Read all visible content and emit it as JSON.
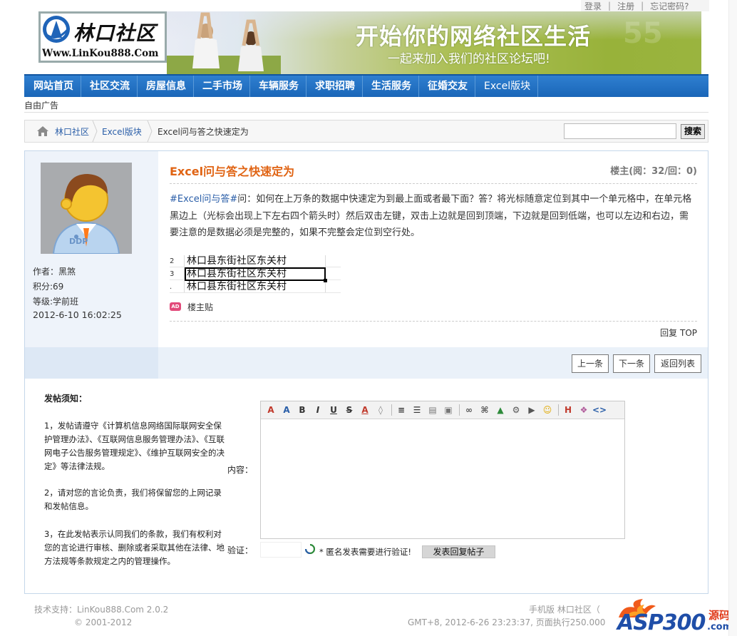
{
  "toplinks": {
    "login": "登录",
    "register": "注册",
    "forgot": "忘记密码?"
  },
  "brand": {
    "logo_text": "林口社区",
    "logo_url": "Www.LinKou888.Com"
  },
  "banner": {
    "slogan": "开始你的网络社区生活",
    "subslogan": "一起来加入我们的社区论坛吧!"
  },
  "nav": {
    "items": [
      "网站首页",
      "社区交流",
      "房屋信息",
      "二手市场",
      "车辆服务",
      "求职招聘",
      "生活服务",
      "征婚交友",
      "Excel版块"
    ]
  },
  "free_ad": "自由广告",
  "breadcrumb": {
    "items": [
      "林口社区",
      "Excel版块",
      "Excel问与答之快速定为"
    ]
  },
  "search": {
    "button": "搜索",
    "placeholder": ""
  },
  "author": {
    "name_line": "作者：黑煞",
    "points_line": "积分:69",
    "level_line": "等级:学前班",
    "date": "2012-6-10 16:02:25"
  },
  "post": {
    "title": "Excel问与答之快速定为",
    "stats": "楼主(阅：32/回：0)",
    "tag": "#Excel问与答#",
    "body": "问：如何在上万条的数据中快速定为到最上面或者最下面？答？将光标随意定位到其中一个单元格中，在单元格黑边上（光标会出现上下左右四个箭头时）然后双击左键，双击上边就是回到顶端，下边就是回到低端，也可以左边和右边，需要注意的是数据必须是完整的，如果不完整会定位到空行处。",
    "excel_rows": [
      {
        "num": "2",
        "text": "林口县东街社区东关村"
      },
      {
        "num": "3",
        "text": "林口县东街社区东关村"
      },
      {
        "num": ".",
        "text": "林口县东街社区东关村"
      }
    ],
    "badge": "AD",
    "floor_label": "楼主贴",
    "reply_top": "回复 TOP"
  },
  "pager": {
    "prev": "上一条",
    "next": "下一条",
    "back": "返回列表"
  },
  "rules": {
    "title": "发帖须知：",
    "r1": "1，发帖请遵守《计算机信息网络国际联网安全保护管理办法》、《互联网信息服务管理办法》、《互联网电子公告服务管理规定》、《维护互联网安全的决定》等法律法规。",
    "r2": "2，请对您的言论负责，我们将保留您的上网记录和发帖信息。",
    "r3": "3，在此发帖表示认同我们的条款，我们有权利对您的言论进行审核、删除或者采取其他在法律、地方法规等条款规定之内的管理操作。"
  },
  "form": {
    "content_label": "内容：",
    "verify_label": "验证：",
    "verify_note": "* 匿名发表需要进行验证!",
    "submit": "发表回复帖子"
  },
  "footer": {
    "support": "技术支持：LinKou888.Com 2.0.2",
    "copyright": "© 2001-2012",
    "mobile": "手机版 林口社区（",
    "time": "GMT+8, 2012-6-26 23:23:37, 页面执行250.000",
    "asp_logo": "ASP300",
    "asp_sub": "源码",
    "asp_com": ".com"
  },
  "colors": {
    "nav": "#1a66b8",
    "title": "#e06414",
    "link": "#2a5ea8"
  }
}
